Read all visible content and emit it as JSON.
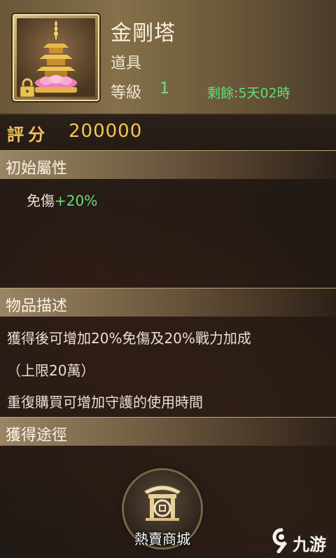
{
  "item": {
    "name": "金剛塔",
    "type": "道具",
    "level_label": "等級",
    "level_value": "1",
    "remaining": "剩餘:5天02時",
    "icon": "pagoda-icon",
    "locked_icon": "lock-icon"
  },
  "score": {
    "label": "評分",
    "value": "200000"
  },
  "sections": {
    "initial_attributes": {
      "title": "初始屬性",
      "stat_name": "免傷",
      "stat_value": "+20%"
    },
    "description": {
      "title": "物品描述",
      "lines": [
        "獲得後可增加20%免傷及20%戰力加成",
        "（上限20萬）",
        "重復購買可增加守護的使用時間"
      ]
    },
    "acquisition": {
      "title": "獲得途徑",
      "shop_label": "熱賣商城",
      "shop_icon": "shop-gate-icon"
    }
  },
  "watermark": {
    "text": "九游",
    "icon": "nine-game-logo-icon"
  },
  "colors": {
    "gold": "#f5c454",
    "green": "#5fe07a",
    "header": "#85704a"
  }
}
